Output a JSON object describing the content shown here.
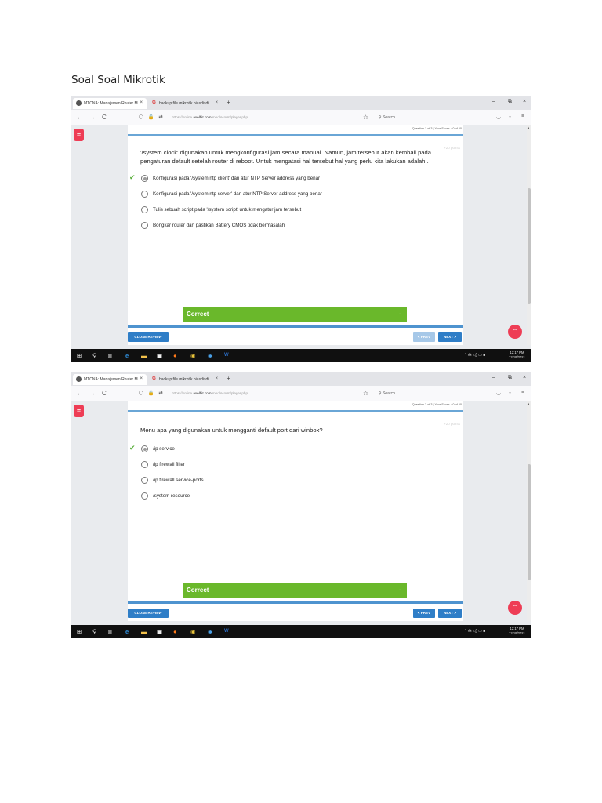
{
  "doc_title": "Soal Soal Mikrotik",
  "browser": {
    "tab_active": "MTCNA: Manajemen Router M",
    "tab_other": "backup file mikrotik biasdisdi",
    "tab_close": "×",
    "tab_new": "+",
    "win_min": "–",
    "win_max": "⧉",
    "win_close": "×",
    "nav_back": "←",
    "nav_forward": "→",
    "nav_reload": "C",
    "url_prefix": "https://online.",
    "url_host": "axelbit.com",
    "url_path": "/mod/scorm/player.php",
    "search_label": "Search",
    "colors": {
      "accent": "#2f7ec7",
      "correct": "#6ab82b",
      "brand": "#ee3d55"
    }
  },
  "screens": [
    {
      "question_info": "Question 1 of 3  |  Your Score: 40 of 50",
      "points": "+20 points",
      "question": "'/system clock' digunakan untuk mengkonfigurasi jam secara manual. Namun, jam tersebut akan kembali pada pengaturan default setelah router di reboot. Untuk mengatasi hal tersebut hal yang perlu kita lakukan adalah..",
      "options": [
        "Konfigurasi pada '/system ntp client' dan atur NTP Server address yang benar",
        "Konfigurasi pada '/system ntp server' dan atur NTP Server address yang benar",
        "Tulis sebuah script pada '/system script' untuk mengatur jam tersebut",
        "Bongkar router dan pastikan Battery CMOS tidak bermasalah"
      ],
      "selected_index": 0,
      "feedback": "Correct",
      "close_review": "CLOSE REVIEW",
      "prev": "< PREV",
      "prev_disabled": true,
      "next": "NEXT >",
      "clock_time": "12:17 PM",
      "clock_date": "12/19/2021"
    },
    {
      "question_info": "Question 2 of 3  |  Your Score: 40 of 50",
      "points": "+20 points",
      "question": "Menu apa yang digunakan untuk mengganti default port dari winbox?",
      "options": [
        "/ip service",
        "/ip firewall filter",
        "/ip firewall service-ports",
        "/system resource"
      ],
      "selected_index": 0,
      "feedback": "Correct",
      "close_review": "CLOSE REVIEW",
      "prev": "< PREV",
      "prev_disabled": false,
      "next": "NEXT >",
      "clock_time": "12:17 PM",
      "clock_date": "12/19/2021"
    }
  ]
}
